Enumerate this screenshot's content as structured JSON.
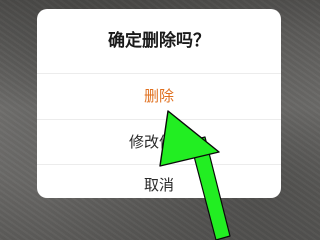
{
  "dialog": {
    "title": "确定删除吗？",
    "options": {
      "delete_label": "删除",
      "edit_label": "修改信息",
      "cancel_label": "取消"
    }
  },
  "colors": {
    "delete_text": "#e0701f",
    "option_text": "#2a2a2a",
    "arrow": "#22ee22"
  },
  "annotation": {
    "icon": "pointer-arrow-icon"
  }
}
